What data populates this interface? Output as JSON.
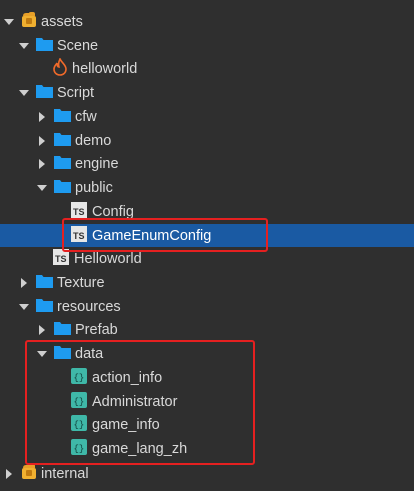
{
  "tree": {
    "items": [
      {
        "label": "assets",
        "icon": "db-folder-icon"
      },
      {
        "label": "Scene",
        "icon": "folder-icon"
      },
      {
        "label": "helloworld",
        "icon": "fire-scene-icon"
      },
      {
        "label": "Script",
        "icon": "folder-icon"
      },
      {
        "label": "cfw",
        "icon": "folder-icon"
      },
      {
        "label": "demo",
        "icon": "folder-icon"
      },
      {
        "label": "engine",
        "icon": "folder-icon"
      },
      {
        "label": "public",
        "icon": "folder-icon"
      },
      {
        "label": "Config",
        "icon": "typescript-file-icon"
      },
      {
        "label": "GameEnumConfig",
        "icon": "typescript-file-icon"
      },
      {
        "label": "Helloworld",
        "icon": "typescript-file-icon"
      },
      {
        "label": "Texture",
        "icon": "folder-icon"
      },
      {
        "label": "resources",
        "icon": "folder-icon"
      },
      {
        "label": "Prefab",
        "icon": "folder-icon"
      },
      {
        "label": "data",
        "icon": "folder-icon"
      },
      {
        "label": "action_info",
        "icon": "json-file-icon"
      },
      {
        "label": "Administrator",
        "icon": "json-file-icon"
      },
      {
        "label": "game_info",
        "icon": "json-file-icon"
      },
      {
        "label": "game_lang_zh",
        "icon": "json-file-icon"
      },
      {
        "label": "internal",
        "icon": "db-folder-icon"
      }
    ],
    "ts_badge": "TS",
    "json_badge": "{}"
  },
  "colors": {
    "background": "#2f2f2f",
    "selection": "#1a5aa3",
    "folder": "#1e9bf0",
    "highlight_box": "#e52020"
  }
}
